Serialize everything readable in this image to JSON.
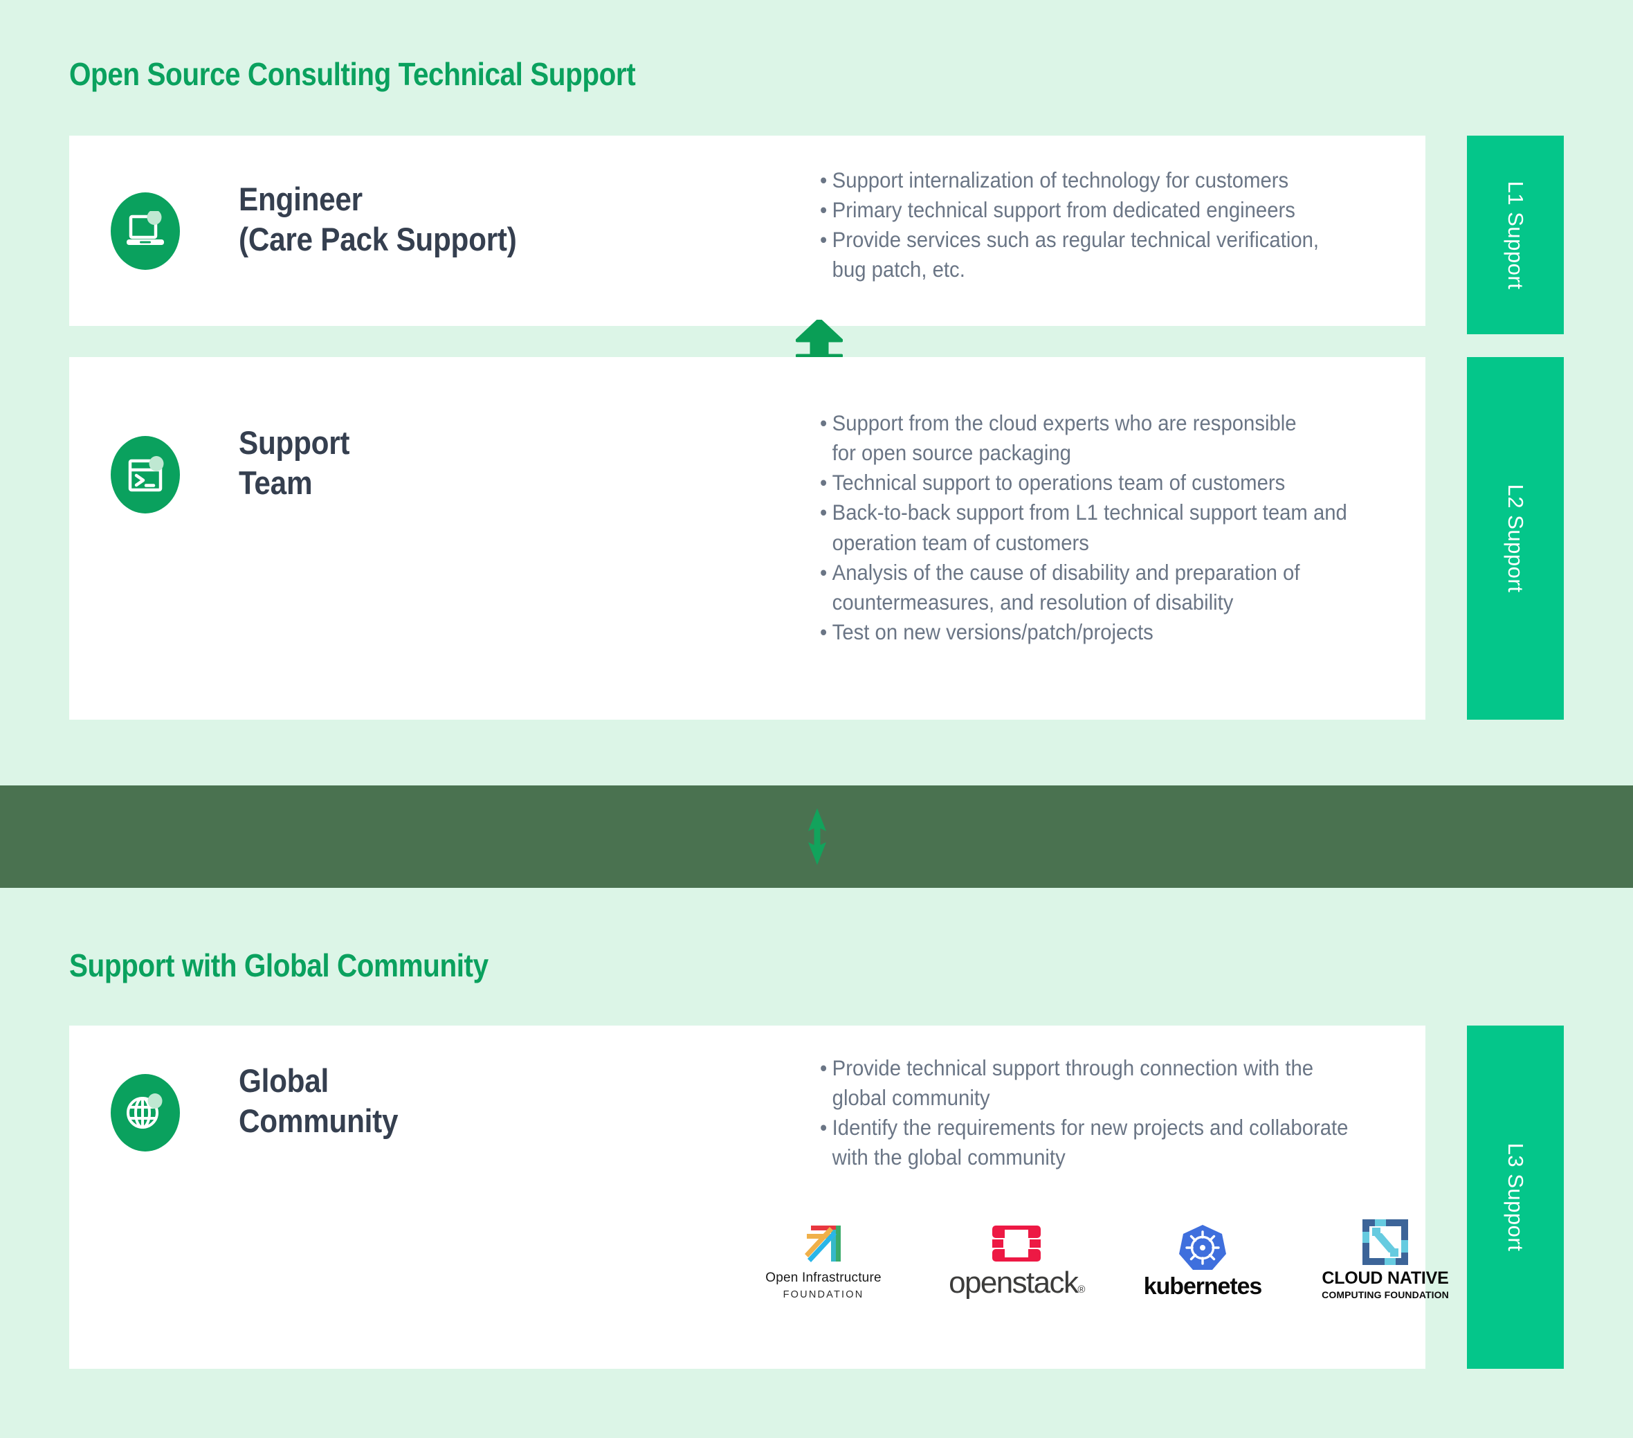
{
  "colors": {
    "page_bg_light": "#dcf5e7",
    "band_dark": "#4a7250",
    "card_bg": "#ffffff",
    "sidebar_green": "#04c68a",
    "title_green": "#0aa15e",
    "icon_green": "#0aa15e",
    "arrow_green": "#0a9e56",
    "heading_navy": "#353f4f",
    "bullet_gray": "#6a7585"
  },
  "sections": [
    {
      "title": "Open Source Consulting Technical Support",
      "cards": [
        {
          "icon": "laptop-icon",
          "heading": "Engineer",
          "subheading": "(Care Pack Support)",
          "bullets": [
            "Support internalization of technology for customers",
            "Primary technical support from dedicated engineers",
            "Provide services such as regular technical verification,\nbug patch, etc."
          ],
          "sidebar_label": "L1 Support"
        },
        {
          "icon": "terminal-icon",
          "heading": "Support",
          "subheading": "Team",
          "bullets": [
            "Support from the cloud experts who are responsible\nfor open source packaging",
            "Technical support to operations team of customers",
            "Back-to-back support from L1 technical support team and\noperation team of customers",
            "Analysis of the cause of disability and preparation of\ncountermeasures, and resolution of disability",
            "Test on new versions/patch/projects"
          ],
          "sidebar_label": "L2 Support"
        }
      ]
    },
    {
      "title": "Support with Global Community",
      "cards": [
        {
          "icon": "globe-icon",
          "heading": "Global",
          "subheading": "Community",
          "bullets": [
            "Provide technical support through connection with the\nglobal community",
            "Identify the requirements for new projects and collaborate\nwith the global community"
          ],
          "sidebar_label": "L3 Support"
        }
      ]
    }
  ],
  "arrows": {
    "between_cards": "double-headed-vertical-arrow",
    "between_sections": "double-headed-vertical-arrow"
  },
  "logos": [
    {
      "name": "open-infrastructure-foundation-logo",
      "caption_line1": "Open Infrastructure",
      "caption_line2": "FOUNDATION"
    },
    {
      "name": "openstack-logo",
      "caption_line1": "openstack",
      "caption_line2": "®"
    },
    {
      "name": "kubernetes-logo",
      "caption_line1": "kubernetes",
      "caption_line2": ""
    },
    {
      "name": "cncf-logo",
      "caption_line1": "CLOUD NATIVE",
      "caption_line2": "COMPUTING FOUNDATION"
    }
  ]
}
